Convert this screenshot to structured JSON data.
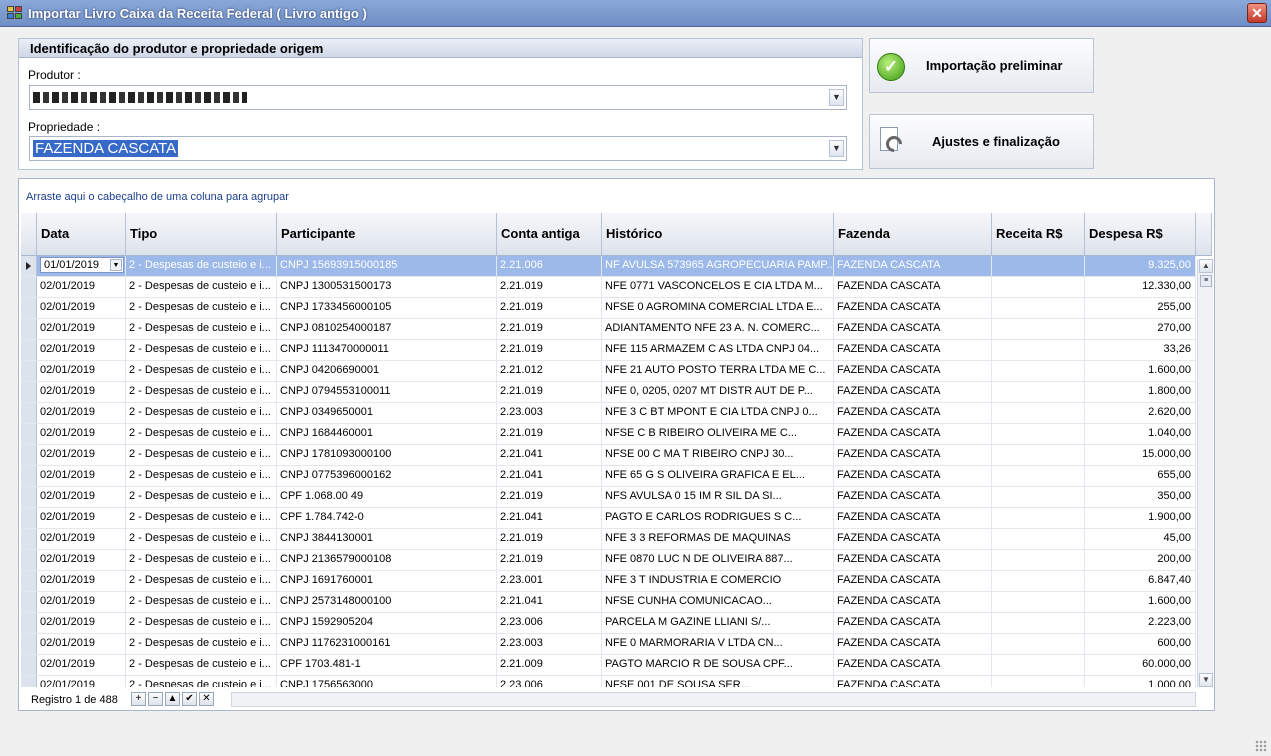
{
  "window": {
    "title": "Importar Livro Caixa da Receita Federal ( Livro antigo )",
    "close_label": "✕"
  },
  "group": {
    "title": "Identificação do produtor e propriedade origem",
    "producer_label": "Produtor :",
    "producer_value": "",
    "property_label": "Propriedade :",
    "property_value": "FAZENDA CASCATA"
  },
  "buttons": {
    "preliminary": "Importação preliminar",
    "finalize": "Ajustes e finalização"
  },
  "grid": {
    "group_hint": "Arraste aqui o cabeçalho de uma coluna para agrupar",
    "columns": [
      "Data",
      "Tipo",
      "Participante",
      "Conta antiga",
      "Histórico",
      "Fazenda",
      "Receita R$",
      "Despesa R$"
    ],
    "rows": [
      [
        "01/01/2019",
        "2 - Despesas de custeio e i...",
        "CNPJ 15693915000185",
        "2.21.006",
        "NF AVULSA 573965 AGROPECUARIA PAMP...",
        "FAZENDA CASCATA",
        "",
        "9.325,00"
      ],
      [
        "02/01/2019",
        "2 - Despesas de custeio e i...",
        "CNPJ 1300531500173",
        "2.21.019",
        "NFE 0771 VASCONCELOS E CIA LTDA M...",
        "FAZENDA CASCATA",
        "",
        "12.330,00"
      ],
      [
        "02/01/2019",
        "2 - Despesas de custeio e i...",
        "CNPJ 1733456000105",
        "2.21.019",
        "NFSE 0 AGROMINA COMERCIAL LTDA E...",
        "FAZENDA CASCATA",
        "",
        "255,00"
      ],
      [
        "02/01/2019",
        "2 - Despesas de custeio e i...",
        "CNPJ 0810254000187",
        "2.21.019",
        "ADIANTAMENTO NFE 23 A. N. COMERC...",
        "FAZENDA CASCATA",
        "",
        "270,00"
      ],
      [
        "02/01/2019",
        "2 - Despesas de custeio e i...",
        "CNPJ 1113470000011",
        "2.21.019",
        "NFE 115 ARMAZEM C AS LTDA CNPJ 04...",
        "FAZENDA CASCATA",
        "",
        "33,26"
      ],
      [
        "02/01/2019",
        "2 - Despesas de custeio e i...",
        "CNPJ 04206690001",
        "2.21.012",
        "NFE 21 AUTO POSTO TERRA LTDA ME C...",
        "FAZENDA CASCATA",
        "",
        "1.600,00"
      ],
      [
        "02/01/2019",
        "2 - Despesas de custeio e i...",
        "CNPJ 0794553100011",
        "2.21.019",
        "NFE 0, 0205, 0207 MT DISTR AUT DE P...",
        "FAZENDA CASCATA",
        "",
        "1.800,00"
      ],
      [
        "02/01/2019",
        "2 - Despesas de custeio e i...",
        "CNPJ 0349650001",
        "2.23.003",
        "NFE 3 C BT MPONT E CIA LTDA CNPJ 0...",
        "FAZENDA CASCATA",
        "",
        "2.620,00"
      ],
      [
        "02/01/2019",
        "2 - Despesas de custeio e i...",
        "CNPJ 1684460001",
        "2.21.019",
        "NFSE C B RIBEIRO OLIVEIRA ME C...",
        "FAZENDA CASCATA",
        "",
        "1.040,00"
      ],
      [
        "02/01/2019",
        "2 - Despesas de custeio e i...",
        "CNPJ 1781093000100",
        "2.21.041",
        "NFSE 00 C MA T RIBEIRO CNPJ 30...",
        "FAZENDA CASCATA",
        "",
        "15.000,00"
      ],
      [
        "02/01/2019",
        "2 - Despesas de custeio e i...",
        "CNPJ 0775396000162",
        "2.21.041",
        "NFE 65 G S OLIVEIRA GRAFICA E EL...",
        "FAZENDA CASCATA",
        "",
        "655,00"
      ],
      [
        "02/01/2019",
        "2 - Despesas de custeio e i...",
        "CPF 1.068.00 49",
        "2.21.019",
        "NFS AVULSA 0 15 IM R SIL DA SI...",
        "FAZENDA CASCATA",
        "",
        "350,00"
      ],
      [
        "02/01/2019",
        "2 - Despesas de custeio e i...",
        "CPF 1.784.742-0",
        "2.21.041",
        "PAGTO E CARLOS RODRIGUES S C...",
        "FAZENDA CASCATA",
        "",
        "1.900,00"
      ],
      [
        "02/01/2019",
        "2 - Despesas de custeio e i...",
        "CNPJ 3844130001",
        "2.21.019",
        "NFE 3 3 REFORMAS DE MAQUINAS",
        "FAZENDA CASCATA",
        "",
        "45,00"
      ],
      [
        "02/01/2019",
        "2 - Despesas de custeio e i...",
        "CNPJ 2136579000108",
        "2.21.019",
        "NFE 0870 LUC N DE OLIVEIRA 887...",
        "FAZENDA CASCATA",
        "",
        "200,00"
      ],
      [
        "02/01/2019",
        "2 - Despesas de custeio e i...",
        "CNPJ 1691760001",
        "2.23.001",
        "NFE 3 T INDUSTRIA E COMERCIO",
        "FAZENDA CASCATA",
        "",
        "6.847,40"
      ],
      [
        "02/01/2019",
        "2 - Despesas de custeio e i...",
        "CNPJ 2573148000100",
        "2.21.041",
        "NFSE CUNHA COMUNICACAO...",
        "FAZENDA CASCATA",
        "",
        "1.600,00"
      ],
      [
        "02/01/2019",
        "2 - Despesas de custeio e i...",
        "CNPJ 1592905204",
        "2.23.006",
        "PARCELA M GAZINE LLIANI S/...",
        "FAZENDA CASCATA",
        "",
        "2.223,00"
      ],
      [
        "02/01/2019",
        "2 - Despesas de custeio e i...",
        "CNPJ 1176231000161",
        "2.23.003",
        "NFE 0 MARMORARIA V LTDA CN...",
        "FAZENDA CASCATA",
        "",
        "600,00"
      ],
      [
        "02/01/2019",
        "2 - Despesas de custeio e i...",
        "CPF 1703.481-1",
        "2.21.009",
        "PAGTO MARCIO R DE SOUSA CPF...",
        "FAZENDA CASCATA",
        "",
        "60.000,00"
      ],
      [
        "02/01/2019",
        "2 - Despesas de custeio e i...",
        "CNPJ 1756563000",
        "2.23.006",
        "NFSE 001 DE SOUSA SER...",
        "FAZENDA CASCATA",
        "",
        "1.000,00"
      ]
    ],
    "record_status": "Registro 1 de 488",
    "nav_buttons": [
      "+",
      "−",
      "▲",
      "✔",
      "✕"
    ]
  }
}
